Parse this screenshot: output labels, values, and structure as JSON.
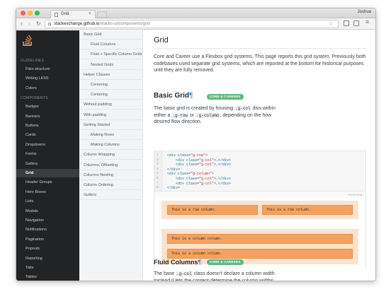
{
  "browser": {
    "tab_title": "Grid",
    "tab_close": "×",
    "user": "Joshua",
    "url_host": "stackexchange.github.io",
    "url_path": "/stacks-ui/components/grid",
    "back": "‹",
    "forward": "›",
    "reload": "↻",
    "star": "☆",
    "menu": "≡"
  },
  "sidebar": {
    "sections": [
      {
        "heading": "GUIDELINES",
        "items": [
          "Files structure",
          "Writing LESS",
          "Colors"
        ]
      },
      {
        "heading": "COMPONENTS",
        "items": [
          "Badges",
          "Banners",
          "Buttons",
          "Cards",
          "Dropdowns",
          "Forms",
          "Gallery",
          "Grid",
          "Header Groups",
          "Hero Boxes",
          "Lists",
          "Modals",
          "Navigation",
          "Notifications",
          "Pagination",
          "Popouts",
          "Reporting",
          "Tabs",
          "Tables"
        ]
      }
    ],
    "active": "Grid"
  },
  "subnav": {
    "items": [
      {
        "label": "Basic Grid",
        "sub": false
      },
      {
        "label": "Fluid Columns",
        "sub": true
      },
      {
        "label": "Fluid + Specific Column Grids",
        "sub": true
      },
      {
        "label": "Nested Grids",
        "sub": true
      },
      {
        "label": "Helper Classes",
        "sub": false
      },
      {
        "label": "Centering",
        "sub": true
      },
      {
        "label": "Centering",
        "sub": true
      },
      {
        "label": "Without padding",
        "sub": false
      },
      {
        "label": "With padding",
        "sub": false
      },
      {
        "label": "Getting Started",
        "sub": false
      },
      {
        "label": "Making Rows",
        "sub": true
      },
      {
        "label": "Making Columns",
        "sub": true
      },
      {
        "label": "Column Wrapping",
        "sub": false
      },
      {
        "label": "Columns, Offsetting",
        "sub": false
      },
      {
        "label": "Columns Nesting",
        "sub": false
      },
      {
        "label": "Column Ordering",
        "sub": false
      },
      {
        "label": "Gutters",
        "sub": false
      }
    ]
  },
  "main": {
    "title": "Grid",
    "intro": "Core and Career use a Flexbox grid systems. This page reports this grid system. Previously both codebases used separate grid systems, which are reported at the bottom for historical purposes until they are fully removed.",
    "basic": {
      "heading": "Basic Grid",
      "pilcrow": "¶",
      "badge": "CORE & CAREERS",
      "text_a": "The basic grid is created by housing ",
      "code_a": ".g-col",
      "text_b": " divs within either a ",
      "code_b": ".g-row",
      "text_c": " or ",
      "code_c": ".g-column",
      "text_d": ", depending on the how desired flow direction."
    },
    "code_lines": [
      {
        "n": "1",
        "indent": "",
        "open": "<div class=",
        "cls": "\"g-row\"",
        "close": ">"
      },
      {
        "n": "2",
        "indent": "    ",
        "open": "<div class=",
        "cls": "\"g-col\"",
        "close": ">…</div>"
      },
      {
        "n": "3",
        "indent": "    ",
        "open": "<div class=",
        "cls": "\"g-col\"",
        "close": ">…</div>"
      },
      {
        "n": "4",
        "indent": "",
        "open": "</div>",
        "cls": "",
        "close": ""
      },
      {
        "n": "5",
        "indent": "",
        "open": "<div class=",
        "cls": "\"g-column\"",
        "close": ">"
      },
      {
        "n": "6",
        "indent": "    ",
        "open": "<div class=",
        "cls": "\"g-col\"",
        "close": ">…</div>"
      },
      {
        "n": "7",
        "indent": "    ",
        "open": "<div class=",
        "cls": "\"g-col\"",
        "close": ">…</div>"
      },
      {
        "n": "8",
        "indent": "",
        "open": "</div>",
        "cls": "",
        "close": ""
      }
    ],
    "preview_label": "PREVIEW",
    "row_cols": [
      "This is a row column.",
      "This is a row column."
    ],
    "column_cols": [
      "This is a column column.",
      "This is a column column."
    ],
    "fluid": {
      "heading": "Fluid Columns",
      "pilcrow": "¶",
      "badge": "CORE & CAREERS",
      "text_a": "The base ",
      "code_a": ".g-col",
      "text_b": " class doesn't declare a column width. Instead it lets the content determine the column widths automatically within"
    }
  },
  "colors": {
    "accent": "#0077cc",
    "badge": "#5eba7d",
    "demo_bg": "#fbe3cd",
    "col_bg": "#f3a35f",
    "sidebar_bg": "#222325"
  }
}
